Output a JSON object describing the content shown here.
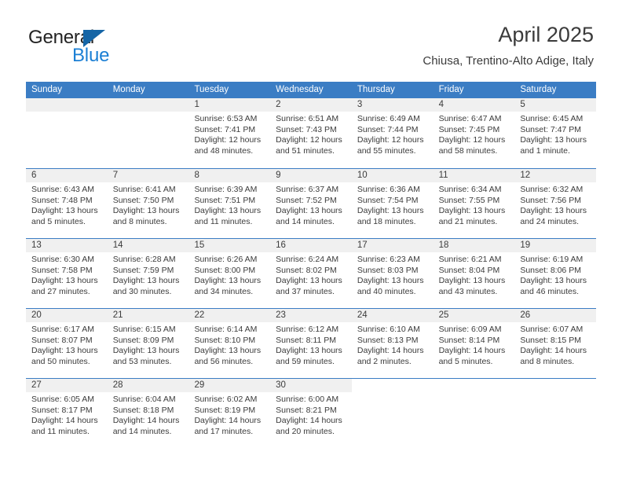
{
  "brand": {
    "name_primary": "General",
    "name_secondary": "Blue",
    "triangle_icon": "triangle-icon",
    "accent_color": "#1b7fd4",
    "header_color": "#3b7dc4"
  },
  "header": {
    "title": "April 2025",
    "subtitle": "Chiusa, Trentino-Alto Adige, Italy"
  },
  "calendar": {
    "weekday_headers": [
      "Sunday",
      "Monday",
      "Tuesday",
      "Wednesday",
      "Thursday",
      "Friday",
      "Saturday"
    ],
    "weeks": [
      [
        {
          "day": "",
          "blank": true
        },
        {
          "day": "",
          "blank": true
        },
        {
          "day": "1",
          "sunrise": "Sunrise: 6:53 AM",
          "sunset": "Sunset: 7:41 PM",
          "daylight": "Daylight: 12 hours and 48 minutes."
        },
        {
          "day": "2",
          "sunrise": "Sunrise: 6:51 AM",
          "sunset": "Sunset: 7:43 PM",
          "daylight": "Daylight: 12 hours and 51 minutes."
        },
        {
          "day": "3",
          "sunrise": "Sunrise: 6:49 AM",
          "sunset": "Sunset: 7:44 PM",
          "daylight": "Daylight: 12 hours and 55 minutes."
        },
        {
          "day": "4",
          "sunrise": "Sunrise: 6:47 AM",
          "sunset": "Sunset: 7:45 PM",
          "daylight": "Daylight: 12 hours and 58 minutes."
        },
        {
          "day": "5",
          "sunrise": "Sunrise: 6:45 AM",
          "sunset": "Sunset: 7:47 PM",
          "daylight": "Daylight: 13 hours and 1 minute."
        }
      ],
      [
        {
          "day": "6",
          "sunrise": "Sunrise: 6:43 AM",
          "sunset": "Sunset: 7:48 PM",
          "daylight": "Daylight: 13 hours and 5 minutes."
        },
        {
          "day": "7",
          "sunrise": "Sunrise: 6:41 AM",
          "sunset": "Sunset: 7:50 PM",
          "daylight": "Daylight: 13 hours and 8 minutes."
        },
        {
          "day": "8",
          "sunrise": "Sunrise: 6:39 AM",
          "sunset": "Sunset: 7:51 PM",
          "daylight": "Daylight: 13 hours and 11 minutes."
        },
        {
          "day": "9",
          "sunrise": "Sunrise: 6:37 AM",
          "sunset": "Sunset: 7:52 PM",
          "daylight": "Daylight: 13 hours and 14 minutes."
        },
        {
          "day": "10",
          "sunrise": "Sunrise: 6:36 AM",
          "sunset": "Sunset: 7:54 PM",
          "daylight": "Daylight: 13 hours and 18 minutes."
        },
        {
          "day": "11",
          "sunrise": "Sunrise: 6:34 AM",
          "sunset": "Sunset: 7:55 PM",
          "daylight": "Daylight: 13 hours and 21 minutes."
        },
        {
          "day": "12",
          "sunrise": "Sunrise: 6:32 AM",
          "sunset": "Sunset: 7:56 PM",
          "daylight": "Daylight: 13 hours and 24 minutes."
        }
      ],
      [
        {
          "day": "13",
          "sunrise": "Sunrise: 6:30 AM",
          "sunset": "Sunset: 7:58 PM",
          "daylight": "Daylight: 13 hours and 27 minutes."
        },
        {
          "day": "14",
          "sunrise": "Sunrise: 6:28 AM",
          "sunset": "Sunset: 7:59 PM",
          "daylight": "Daylight: 13 hours and 30 minutes."
        },
        {
          "day": "15",
          "sunrise": "Sunrise: 6:26 AM",
          "sunset": "Sunset: 8:00 PM",
          "daylight": "Daylight: 13 hours and 34 minutes."
        },
        {
          "day": "16",
          "sunrise": "Sunrise: 6:24 AM",
          "sunset": "Sunset: 8:02 PM",
          "daylight": "Daylight: 13 hours and 37 minutes."
        },
        {
          "day": "17",
          "sunrise": "Sunrise: 6:23 AM",
          "sunset": "Sunset: 8:03 PM",
          "daylight": "Daylight: 13 hours and 40 minutes."
        },
        {
          "day": "18",
          "sunrise": "Sunrise: 6:21 AM",
          "sunset": "Sunset: 8:04 PM",
          "daylight": "Daylight: 13 hours and 43 minutes."
        },
        {
          "day": "19",
          "sunrise": "Sunrise: 6:19 AM",
          "sunset": "Sunset: 8:06 PM",
          "daylight": "Daylight: 13 hours and 46 minutes."
        }
      ],
      [
        {
          "day": "20",
          "sunrise": "Sunrise: 6:17 AM",
          "sunset": "Sunset: 8:07 PM",
          "daylight": "Daylight: 13 hours and 50 minutes."
        },
        {
          "day": "21",
          "sunrise": "Sunrise: 6:15 AM",
          "sunset": "Sunset: 8:09 PM",
          "daylight": "Daylight: 13 hours and 53 minutes."
        },
        {
          "day": "22",
          "sunrise": "Sunrise: 6:14 AM",
          "sunset": "Sunset: 8:10 PM",
          "daylight": "Daylight: 13 hours and 56 minutes."
        },
        {
          "day": "23",
          "sunrise": "Sunrise: 6:12 AM",
          "sunset": "Sunset: 8:11 PM",
          "daylight": "Daylight: 13 hours and 59 minutes."
        },
        {
          "day": "24",
          "sunrise": "Sunrise: 6:10 AM",
          "sunset": "Sunset: 8:13 PM",
          "daylight": "Daylight: 14 hours and 2 minutes."
        },
        {
          "day": "25",
          "sunrise": "Sunrise: 6:09 AM",
          "sunset": "Sunset: 8:14 PM",
          "daylight": "Daylight: 14 hours and 5 minutes."
        },
        {
          "day": "26",
          "sunrise": "Sunrise: 6:07 AM",
          "sunset": "Sunset: 8:15 PM",
          "daylight": "Daylight: 14 hours and 8 minutes."
        }
      ],
      [
        {
          "day": "27",
          "sunrise": "Sunrise: 6:05 AM",
          "sunset": "Sunset: 8:17 PM",
          "daylight": "Daylight: 14 hours and 11 minutes."
        },
        {
          "day": "28",
          "sunrise": "Sunrise: 6:04 AM",
          "sunset": "Sunset: 8:18 PM",
          "daylight": "Daylight: 14 hours and 14 minutes."
        },
        {
          "day": "29",
          "sunrise": "Sunrise: 6:02 AM",
          "sunset": "Sunset: 8:19 PM",
          "daylight": "Daylight: 14 hours and 17 minutes."
        },
        {
          "day": "30",
          "sunrise": "Sunrise: 6:00 AM",
          "sunset": "Sunset: 8:21 PM",
          "daylight": "Daylight: 14 hours and 20 minutes."
        },
        {
          "day": "",
          "empty": true
        },
        {
          "day": "",
          "empty": true
        },
        {
          "day": "",
          "empty": true
        }
      ]
    ]
  }
}
